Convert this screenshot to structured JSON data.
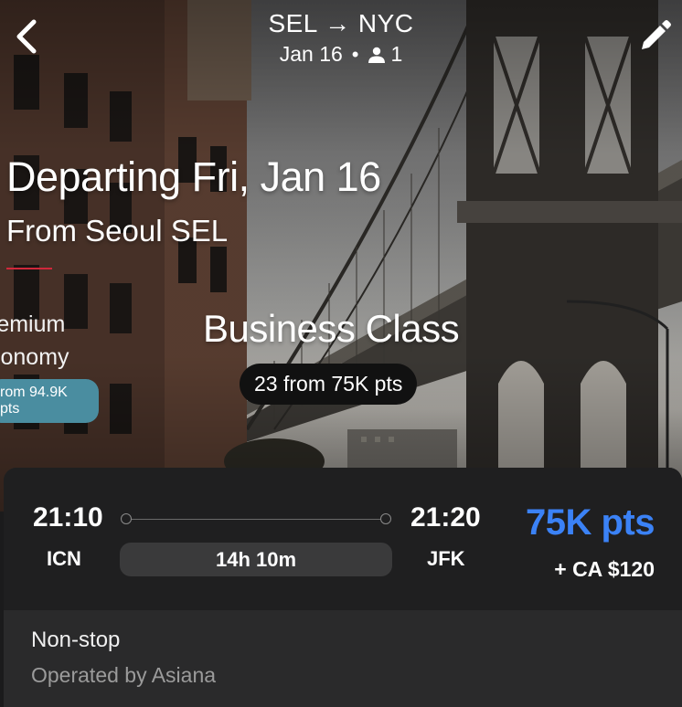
{
  "header": {
    "route_from": "SEL",
    "route_arrow": "→",
    "route_to": "NYC",
    "date": "Jan 16",
    "separator": "•",
    "passengers": "1"
  },
  "heading": {
    "departing": "Departing Fri, Jan 16",
    "from": "From Seoul SEL"
  },
  "cabins": {
    "previous": {
      "name_line1": "remium",
      "name_line2": "conomy",
      "price": "rom 94.9K pts"
    },
    "current": {
      "name": "Business Class",
      "summary": "23 from 75K pts"
    }
  },
  "flight": {
    "depart_time": "21:10",
    "depart_airport": "ICN",
    "arrive_time": "21:20",
    "arrive_airport": "JFK",
    "duration": "14h 10m",
    "points": "75K pts",
    "cash": "+ CA $120",
    "stops": "Non-stop",
    "operator": "Operated by Asiana"
  },
  "colors": {
    "accent_red": "#d0283b",
    "points_blue": "#3b82f6",
    "chip_teal": "#4a8da0"
  },
  "icons": {
    "back": "chevron-left-icon",
    "edit": "pencil-icon",
    "passenger": "person-icon"
  }
}
